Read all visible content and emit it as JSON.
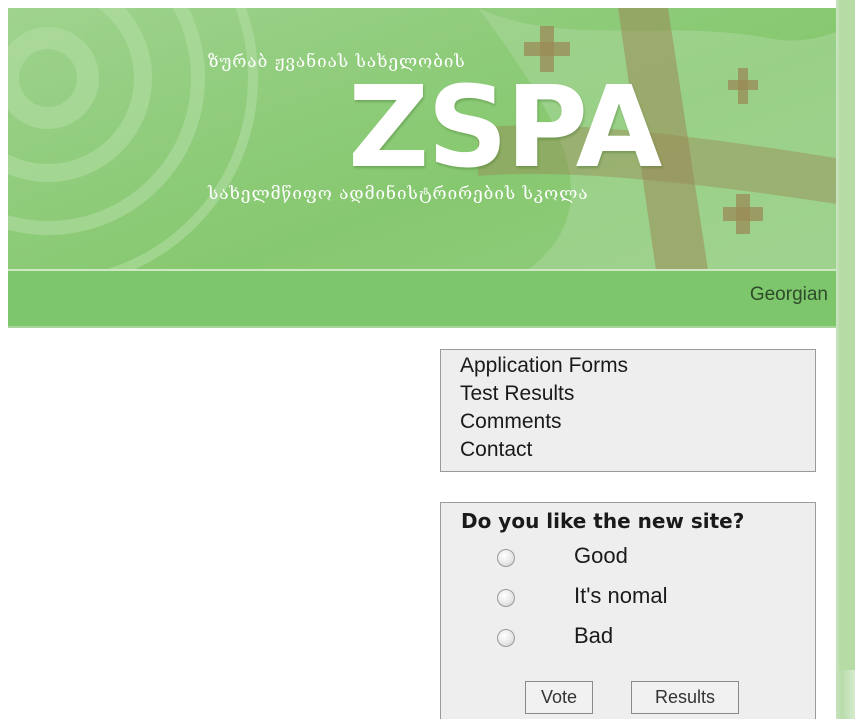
{
  "header": {
    "georgian_line_1": "ზურაბ ჟვანიას სახელობის",
    "logo_text": "ZSPA",
    "georgian_line_2": "სახელმწიფო ადმინისტრირების სკოლა"
  },
  "nav": {
    "language_link": "Georgian"
  },
  "menu": {
    "items": [
      {
        "label": "Application Forms"
      },
      {
        "label": "Test Results"
      },
      {
        "label": "Comments"
      },
      {
        "label": "Contact"
      }
    ]
  },
  "poll": {
    "question": "Do you like the new site?",
    "options": [
      {
        "label": "Good"
      },
      {
        "label": "It's nomal"
      },
      {
        "label": "Bad"
      }
    ],
    "vote_label": "Vote",
    "results_label": "Results"
  },
  "colors": {
    "banner_green": "#8fcc7b",
    "navbar_green": "#7dc66c",
    "box_background": "#eeeeee",
    "flag_cross": "#9a8a55"
  },
  "icons": [
    "georgian-flag-cross-icon",
    "radio-unselected-icon"
  ]
}
